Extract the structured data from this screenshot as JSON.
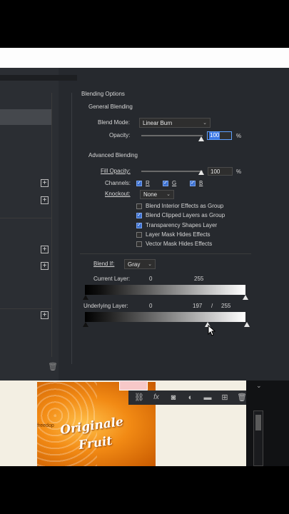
{
  "dialog": {
    "section_title": "Blending Options",
    "general_heading": "General Blending",
    "blend_mode_label": "Blend Mode:",
    "blend_mode_value": "Linear Burn",
    "opacity_label": "Opacity:",
    "opacity_value": "100",
    "opacity_unit": "%",
    "advanced_heading": "Advanced Blending",
    "fill_opacity_label": "Fill Opacity:",
    "fill_opacity_value": "100",
    "fill_opacity_unit": "%",
    "channels_label": "Channels:",
    "channels": [
      {
        "label": "R",
        "checked": true
      },
      {
        "label": "G",
        "checked": true
      },
      {
        "label": "B",
        "checked": true
      }
    ],
    "knockout_label": "Knockout:",
    "knockout_value": "None",
    "options": [
      {
        "label": "Blend Interior Effects as Group",
        "checked": false
      },
      {
        "label": "Blend Clipped Layers as Group",
        "checked": true
      },
      {
        "label": "Transparency Shapes Layer",
        "checked": true
      },
      {
        "label": "Layer Mask Hides Effects",
        "checked": false
      },
      {
        "label": "Vector Mask Hides Effects",
        "checked": false
      }
    ],
    "blend_if_label": "Blend If:",
    "blend_if_value": "Gray",
    "current_layer_label": "Current Layer:",
    "current_layer_low": "0",
    "current_layer_high": "255",
    "underlying_layer_label": "Underlying Layer:",
    "underlying_layer_low": "0",
    "underlying_layer_split_low": "197",
    "underlying_layer_slash": "/",
    "underlying_layer_split_high": "255"
  },
  "layers_panel": {
    "toolbar_icons": [
      "link-icon",
      "fx-icon",
      "mask-icon",
      "adjustment-icon",
      "folder-icon",
      "new-layer-icon",
      "trash-icon"
    ],
    "fx_label": "fx"
  },
  "canvas": {
    "can_brand_line1": "Originale",
    "can_brand_line2": "Fruit",
    "can_small_text": "freedop"
  },
  "colors": {
    "panel_bg": "#26292e",
    "checkbox_on": "#3a6fd0",
    "can_orange": "#f28a14"
  }
}
